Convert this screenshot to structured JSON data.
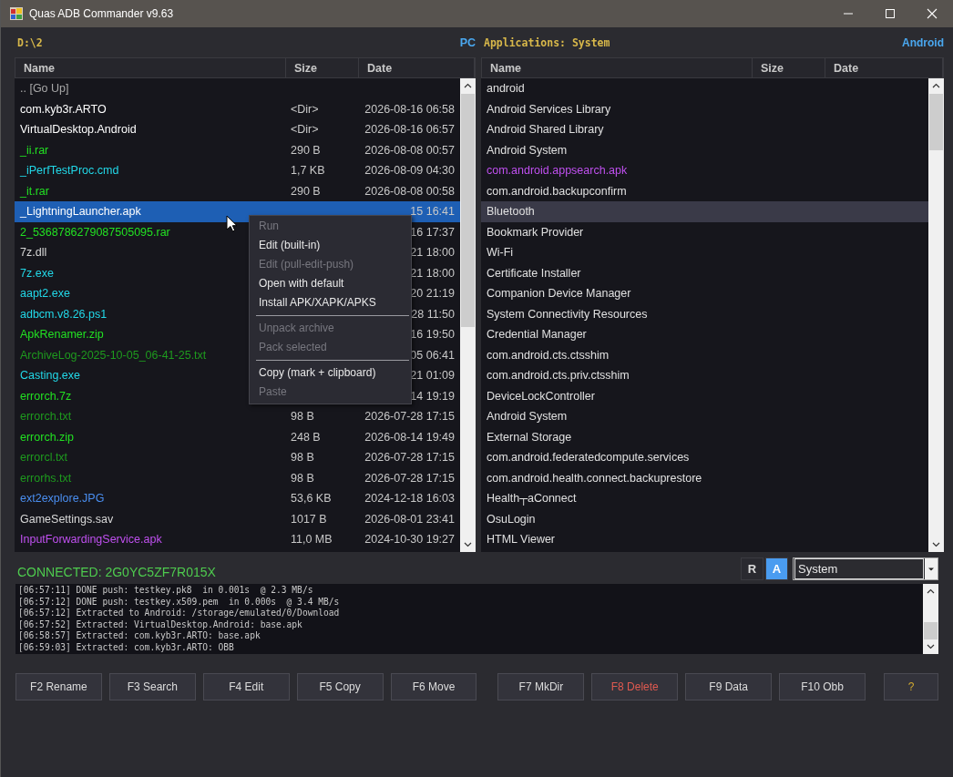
{
  "window": {
    "title": "Quas ADB Commander v9.63"
  },
  "left_panel": {
    "path": "D:\\2",
    "location": "PC",
    "columns": [
      "Name",
      "Size",
      "Date"
    ],
    "rows": [
      {
        "name": ".. [Go Up]",
        "color": "#a8a8a8",
        "selected": false
      },
      {
        "name": "com.kyb3r.ARTO",
        "size": "<Dir>",
        "date": "2026-08-16 06:58",
        "color": "#ffffff",
        "selected": false
      },
      {
        "name": "VirtualDesktop.Android",
        "size": "<Dir>",
        "date": "2026-08-16 06:57",
        "color": "#ffffff",
        "selected": false
      },
      {
        "name": "_ii.rar",
        "size": "290 B",
        "date": "2026-08-08 00:57",
        "color": "#22e022",
        "selected": false
      },
      {
        "name": "_iPerfTestProc.cmd",
        "size": "1,7 KB",
        "date": "2026-08-09 04:30",
        "color": "#22d8e8",
        "selected": false
      },
      {
        "name": "_it.rar",
        "size": "290 B",
        "date": "2026-08-08 00:58",
        "color": "#22e022",
        "selected": false
      },
      {
        "name": "_LightningLauncher.apk",
        "date": "15 16:41",
        "color": "#ffffff",
        "selected": true
      },
      {
        "name": "2_5368786279087505095.rar",
        "date": "16 17:37",
        "color": "#22e022",
        "selected": false
      },
      {
        "name": "7z.dll",
        "date": "21 18:00",
        "color": "#d8d8d8",
        "selected": false
      },
      {
        "name": "7z.exe",
        "date": "21 18:00",
        "color": "#22d8e8",
        "selected": false
      },
      {
        "name": "aapt2.exe",
        "date": "20 21:19",
        "color": "#22d8e8",
        "selected": false
      },
      {
        "name": "adbcm.v8.26.ps1",
        "date": "28 11:50",
        "color": "#22d8e8",
        "selected": false
      },
      {
        "name": "ApkRenamer.zip",
        "date": "16 19:50",
        "color": "#22e022",
        "selected": false
      },
      {
        "name": "ArchiveLog-2025-10-05_06-41-25.txt",
        "date": "05 06:41",
        "color": "#1e9a1e",
        "selected": false
      },
      {
        "name": "Casting.exe",
        "date": "21 01:09",
        "color": "#22d8e8",
        "selected": false
      },
      {
        "name": "errorch.7z",
        "date": "14 19:19",
        "color": "#22e022",
        "selected": false
      },
      {
        "name": "errorch.txt",
        "size": "98 B",
        "date": "2026-07-28 17:15",
        "color": "#1e9a1e",
        "selected": false
      },
      {
        "name": "errorch.zip",
        "size": "248 B",
        "date": "2026-08-14 19:49",
        "color": "#22e022",
        "selected": false
      },
      {
        "name": "errorcl.txt",
        "size": "98 B",
        "date": "2026-07-28 17:15",
        "color": "#1e9a1e",
        "selected": false
      },
      {
        "name": "errorhs.txt",
        "size": "98 B",
        "date": "2026-07-28 17:15",
        "color": "#1e9a1e",
        "selected": false
      },
      {
        "name": "ext2explore.JPG",
        "size": "53,6 KB",
        "date": "2024-12-18 16:03",
        "color": "#4a8ef0",
        "selected": false
      },
      {
        "name": "GameSettings.sav",
        "size": "1017 B",
        "date": "2026-08-01 23:41",
        "color": "#d8d8d8",
        "selected": false
      },
      {
        "name": "InputForwardingService.apk",
        "size": "11,0 MB",
        "date": "2024-10-30 19:27",
        "color": "#c050f0",
        "selected": false
      }
    ]
  },
  "right_panel": {
    "title": "Applications: System",
    "location": "Android",
    "columns": [
      "Name",
      "Size",
      "Date"
    ],
    "rows": [
      {
        "name": "android",
        "color": "#e0e0e0",
        "selected": false
      },
      {
        "name": "Android Services Library",
        "color": "#e0e0e0",
        "selected": false
      },
      {
        "name": "Android Shared Library",
        "color": "#e0e0e0",
        "selected": false
      },
      {
        "name": "Android System",
        "color": "#e0e0e0",
        "selected": false
      },
      {
        "name": "com.android.appsearch.apk",
        "color": "#c050f0",
        "selected": false
      },
      {
        "name": "com.android.backupconfirm",
        "color": "#e0e0e0",
        "selected": false
      },
      {
        "name": "Bluetooth",
        "color": "#e0e0e0",
        "selected": true
      },
      {
        "name": "Bookmark Provider",
        "color": "#e0e0e0",
        "selected": false
      },
      {
        "name": "Wi-Fi",
        "color": "#e0e0e0",
        "selected": false
      },
      {
        "name": "Certificate Installer",
        "color": "#e0e0e0",
        "selected": false
      },
      {
        "name": "Companion Device Manager",
        "color": "#e0e0e0",
        "selected": false
      },
      {
        "name": "System Connectivity Resources",
        "color": "#e0e0e0",
        "selected": false
      },
      {
        "name": "Credential Manager",
        "color": "#e0e0e0",
        "selected": false
      },
      {
        "name": "com.android.cts.ctsshim",
        "color": "#e0e0e0",
        "selected": false
      },
      {
        "name": "com.android.cts.priv.ctsshim",
        "color": "#e0e0e0",
        "selected": false
      },
      {
        "name": "DeviceLockController",
        "color": "#e0e0e0",
        "selected": false
      },
      {
        "name": "Android System",
        "color": "#e0e0e0",
        "selected": false
      },
      {
        "name": "External Storage",
        "color": "#e0e0e0",
        "selected": false
      },
      {
        "name": "com.android.federatedcompute.services",
        "color": "#e0e0e0",
        "selected": false
      },
      {
        "name": "com.android.health.connect.backuprestore",
        "color": "#e0e0e0",
        "selected": false
      },
      {
        "name": "Health┬аConnect",
        "color": "#e0e0e0",
        "selected": false
      },
      {
        "name": "OsuLogin",
        "color": "#e0e0e0",
        "selected": false
      },
      {
        "name": "HTML Viewer",
        "color": "#e0e0e0",
        "selected": false
      }
    ]
  },
  "context_menu": {
    "items": [
      {
        "kind": "item",
        "label": "Run",
        "disabled": true
      },
      {
        "kind": "item",
        "label": "Edit (built-in)",
        "disabled": false
      },
      {
        "kind": "item",
        "label": "Edit (pull-edit-push)",
        "disabled": true
      },
      {
        "kind": "item",
        "label": "Open with default",
        "disabled": false
      },
      {
        "kind": "item",
        "label": "Install APK/XAPK/APKS",
        "disabled": false
      },
      {
        "kind": "separator"
      },
      {
        "kind": "item",
        "label": "Unpack archive",
        "disabled": true
      },
      {
        "kind": "item",
        "label": "Pack selected",
        "disabled": true
      },
      {
        "kind": "separator"
      },
      {
        "kind": "item",
        "label": "Copy (mark + clipboard)",
        "disabled": false
      },
      {
        "kind": "item",
        "label": "Paste",
        "disabled": true
      }
    ]
  },
  "status": {
    "connection": "CONNECTED: 2G0YC5ZF7R015X"
  },
  "mode_toggles": [
    {
      "label": "R",
      "selected": false
    },
    {
      "label": "A",
      "selected": true
    }
  ],
  "filter_dropdown": {
    "value": "System"
  },
  "log": [
    "[06:57:11] DONE push: testkey.pk8  in 0.001s  @ 2.3 MB/s",
    "[06:57:12] DONE push: testkey.x509.pem  in 0.000s  @ 3.4 MB/s",
    "[06:57:12] Extracted to Android: /storage/emulated/0/Download",
    "[06:57:52] Extracted: VirtualDesktop.Android: base.apk",
    "[06:58:57] Extracted: com.kyb3r.ARTO: base.apk",
    "[06:59:03] Extracted: com.kyb3r.ARTO: OBB"
  ],
  "function_keys": [
    {
      "label": "F2 Rename",
      "kind": "normal"
    },
    {
      "label": "F3 Search",
      "kind": "normal"
    },
    {
      "label": "F4 Edit",
      "kind": "normal"
    },
    {
      "label": "F5 Copy",
      "kind": "normal"
    },
    {
      "label": "F6 Move",
      "kind": "normal"
    },
    {
      "label": "F7 MkDir",
      "kind": "normal"
    },
    {
      "label": "F8 Delete",
      "kind": "danger"
    },
    {
      "label": "F9 Data",
      "kind": "normal"
    },
    {
      "label": "F10 Obb",
      "kind": "normal"
    },
    {
      "label": "?",
      "kind": "help"
    }
  ]
}
